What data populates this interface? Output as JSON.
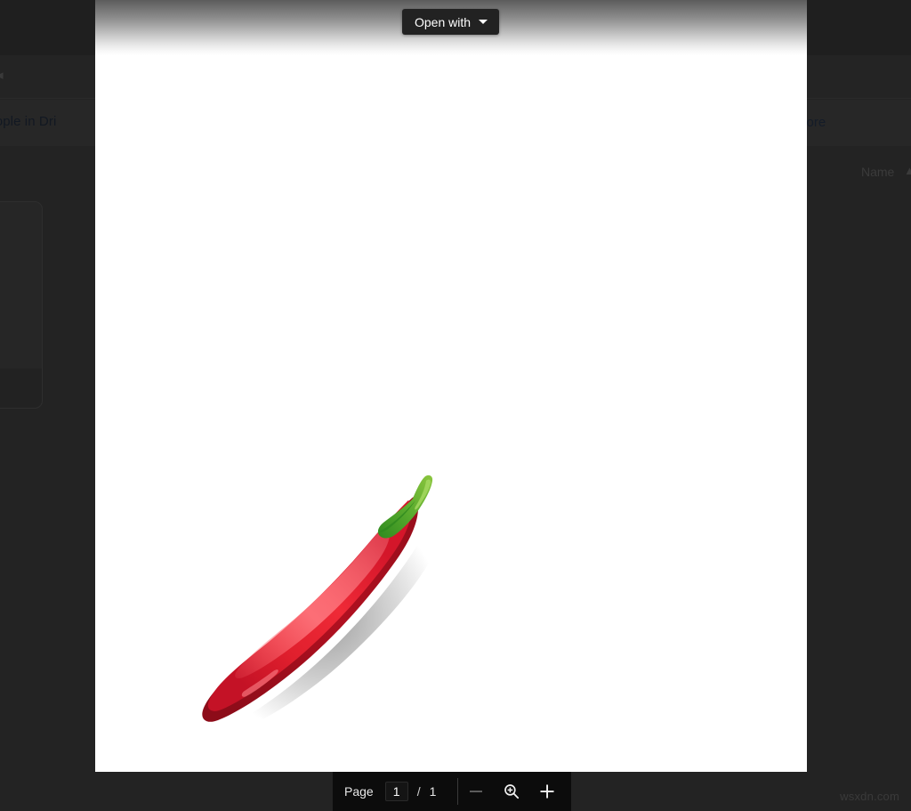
{
  "background_app": {
    "back_caret_icon": "caret-left-icon",
    "banner_text": "k people in Dri",
    "banner_link": "more",
    "column_header_name": "Name",
    "sort_arrow_icon": "sort-ascending-arrow-icon"
  },
  "viewer": {
    "open_with": {
      "label": "Open with",
      "caret_icon": "chevron-down-icon"
    },
    "document": {
      "artwork_name": "red-chili-pepper-sticker",
      "colors": {
        "pepper_light": "#ef2a37",
        "pepper_mid": "#e01f2d",
        "pepper_dark": "#b01020",
        "pepper_shadow": "#8d0c19",
        "stem_light": "#8cc63f",
        "stem_mid": "#4fa32a",
        "stem_dark": "#2f8a1f",
        "outline": "#ffffff",
        "page": "#ffffff"
      }
    }
  },
  "bottom_toolbar": {
    "page_label": "Page",
    "page_current": "1",
    "page_separator": "/",
    "page_total": "1",
    "zoom_out_icon": "minus-icon",
    "zoom_reset_icon": "magnifier-plus-icon",
    "zoom_in_icon": "plus-icon"
  },
  "watermark": "wsxdn.com"
}
